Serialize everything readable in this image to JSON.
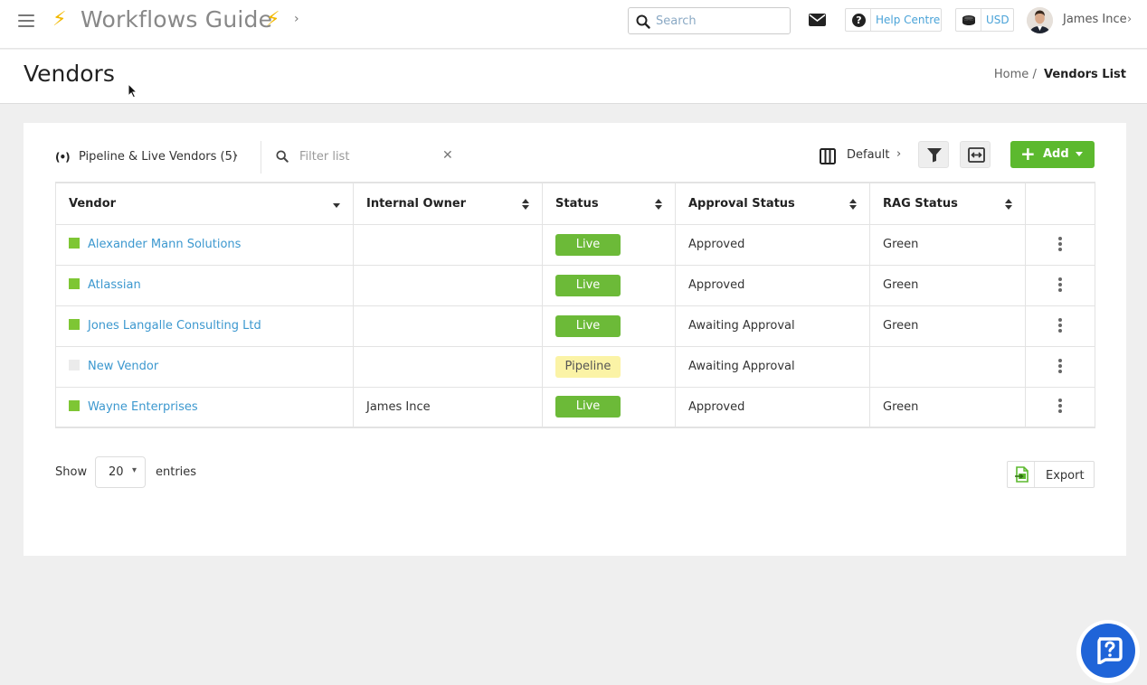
{
  "topbar": {
    "app_title": "Workflows Guide",
    "search_placeholder": "Search",
    "help_label": "Help Centre",
    "currency_label": "USD",
    "user_name": "James Ince"
  },
  "page": {
    "title": "Vendors",
    "breadcrumb": {
      "home": "Home",
      "separator": "/",
      "current": "Vendors List"
    }
  },
  "toolbar": {
    "view_label": "Pipeline & Live Vendors (5)",
    "filter_placeholder": "Filter list",
    "columns_label": "Default",
    "add_label": "Add"
  },
  "table": {
    "columns": [
      "Vendor",
      "Internal Owner",
      "Status",
      "Approval Status",
      "RAG Status"
    ],
    "rows": [
      {
        "vendor": "Alexander Mann Solutions",
        "owner": "",
        "status": "Live",
        "approval": "Approved",
        "rag": "Green"
      },
      {
        "vendor": "Atlassian",
        "owner": "",
        "status": "Live",
        "approval": "Approved",
        "rag": "Green"
      },
      {
        "vendor": "Jones Langalle Consulting Ltd",
        "owner": "",
        "status": "Live",
        "approval": "Awaiting Approval",
        "rag": "Green"
      },
      {
        "vendor": "New Vendor",
        "owner": "",
        "status": "Pipeline",
        "approval": "Awaiting Approval",
        "rag": ""
      },
      {
        "vendor": "Wayne Enterprises",
        "owner": "James Ince",
        "status": "Live",
        "approval": "Approved",
        "rag": "Green"
      }
    ]
  },
  "footer": {
    "show_label": "Show",
    "page_length": "20",
    "entries_label": "entries",
    "export_label": "Export"
  },
  "colors": {
    "accent_green": "#5cb92e",
    "link_blue": "#3c98cf",
    "pipeline_yellow": "#fbf3a6",
    "help_bubble_blue": "#1f64d8"
  },
  "icons": [
    "menu-icon",
    "bolt-icon",
    "search-icon",
    "mail-icon",
    "question-icon",
    "coins-icon",
    "broadcast-icon",
    "columns-icon",
    "filter-icon",
    "expand-icon",
    "plus-icon",
    "kebab-icon",
    "export-icon",
    "help-chat-icon"
  ]
}
